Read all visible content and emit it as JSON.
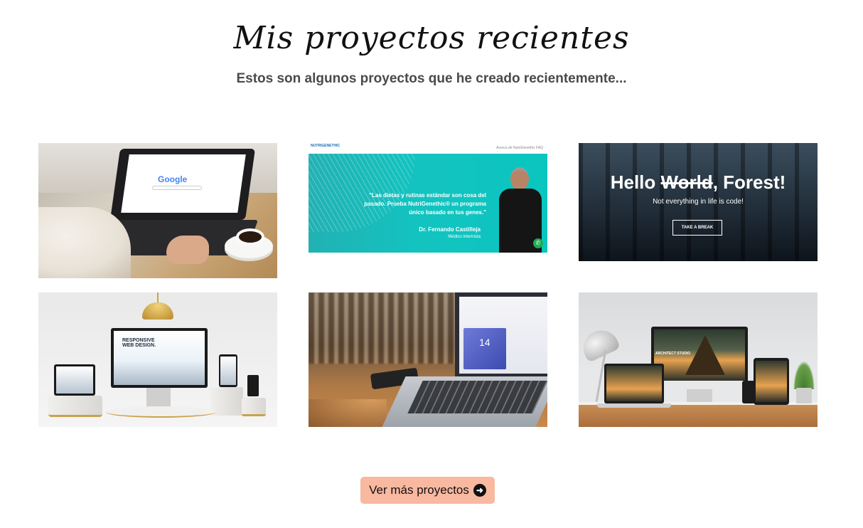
{
  "header": {
    "title": "Mis proyectos recientes",
    "subtitle": "Estos son algunos proyectos que he creado recientemente..."
  },
  "projects": [
    {
      "name": "Google search laptop",
      "screen_text": "Google"
    },
    {
      "name": "NutriGenethic",
      "logo": "NUTRIGENETHIC",
      "nav": "Acerca de NutriGenethic    FAQ",
      "quote": "\"Las dietas y rutinas estándar son cosa del pasado. Prueba NutriGenethic® un programa único basado en tus genes.\"",
      "author": "Dr. Fernando Castilleja",
      "role": "Médico Internista"
    },
    {
      "name": "Hello World Forest",
      "headline_prefix": "Hello ",
      "headline_struck": "World",
      "headline_suffix": ", Forest!",
      "tagline": "Not everything in life is code!",
      "button": "TAKE A BREAK"
    },
    {
      "name": "Responsive Web Design",
      "screen_text": "RESPONSIVE WEB DESIGN."
    },
    {
      "name": "Laptop dashboard",
      "screen_text": "14"
    },
    {
      "name": "Architect Studio",
      "screen_text": "ARCHITECT STUDIO"
    }
  ],
  "cta": {
    "label": "Ver más proyectos",
    "icon": "arrow-right-circle-icon"
  }
}
